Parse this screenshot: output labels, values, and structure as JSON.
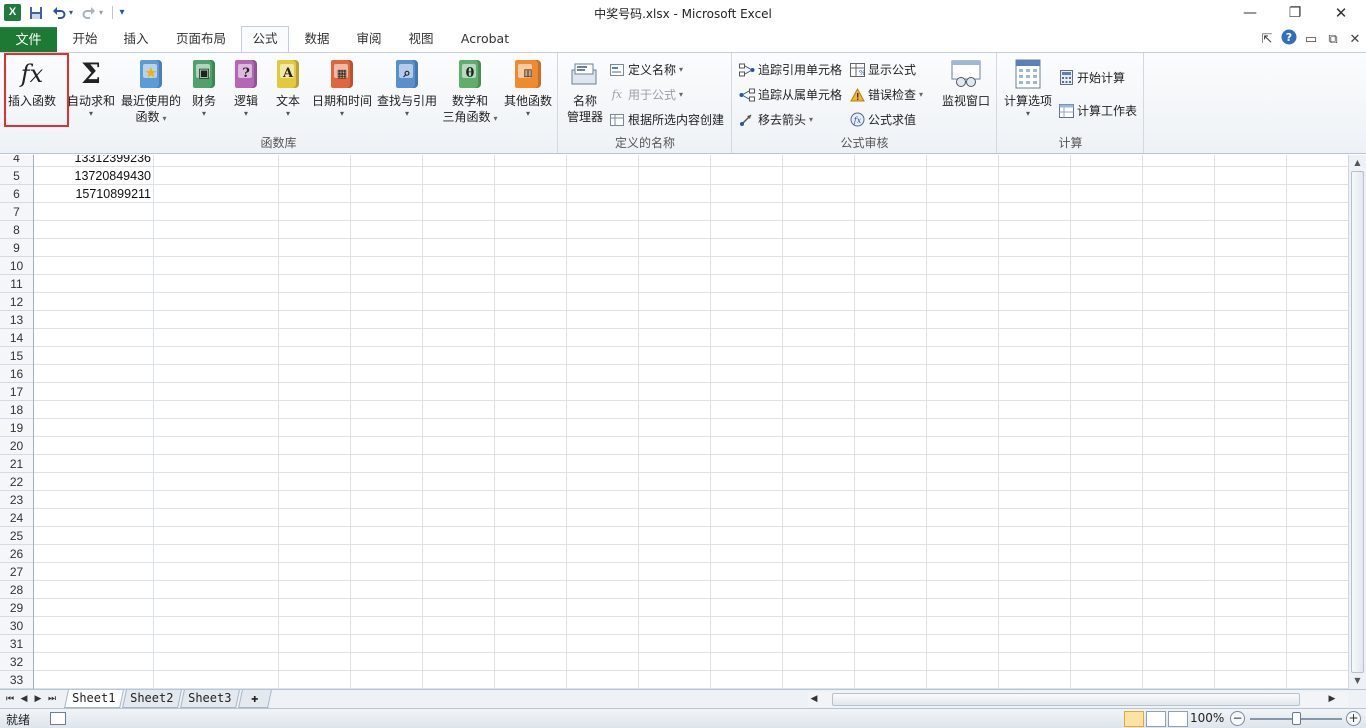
{
  "window": {
    "title": "中奖号码.xlsx  -  Microsoft Excel",
    "app_icon_letter": "X",
    "controls": {
      "minimize": "—",
      "restore": "❐",
      "close": "✕"
    }
  },
  "quick_access": {
    "save_icon": "save-icon",
    "undo_icon": "undo-icon",
    "redo_icon": "redo-icon",
    "customize": "▾"
  },
  "tabs": {
    "file": "文件",
    "items": [
      "开始",
      "插入",
      "页面布局",
      "公式",
      "数据",
      "审阅",
      "视图",
      "Acrobat"
    ],
    "active": "公式"
  },
  "colors": {
    "file_tab": "#1d7a34",
    "highlight_box": "#e0302f",
    "active_view": "#fbe3a4"
  },
  "ribbon": {
    "function_library": {
      "label": "函数库",
      "insert_function": "插入函数",
      "autosum": "自动求和",
      "recently_used": [
        "最近使用的",
        "函数"
      ],
      "financial": "财务",
      "logical": "逻辑",
      "text": "文本",
      "date_time": "日期和时间",
      "lookup": "查找与引用",
      "math": [
        "数学和",
        "三角函数"
      ],
      "more": "其他函数"
    },
    "defined_names": {
      "label": "定义的名称",
      "name_manager": [
        "名称",
        "管理器"
      ],
      "define_name": "定义名称",
      "use_in_formula": "用于公式",
      "create_from_selection": "根据所选内容创建"
    },
    "formula_auditing": {
      "label": "公式审核",
      "trace_precedents": "追踪引用单元格",
      "trace_dependents": "追踪从属单元格",
      "remove_arrows": "移去箭头",
      "show_formulas": "显示公式",
      "error_checking": "错误检查",
      "evaluate_formula": "公式求值",
      "watch_window": "监视窗口"
    },
    "calculation": {
      "label": "计算",
      "calc_options": "计算选项",
      "calc_now": "开始计算",
      "calc_sheet": "计算工作表"
    }
  },
  "sheet": {
    "row_numbers": [
      "4",
      "5",
      "6",
      "7",
      "8",
      "9",
      "10",
      "11",
      "12",
      "13",
      "14",
      "15",
      "16",
      "17",
      "18",
      "19",
      "20",
      "21",
      "22",
      "23",
      "24",
      "25",
      "26",
      "27",
      "28",
      "29",
      "30",
      "31",
      "32",
      "33"
    ],
    "column_a_values": [
      "13312399236",
      "13720849430",
      "15710899211"
    ]
  },
  "sheet_tabs": [
    "Sheet1",
    "Sheet2",
    "Sheet3"
  ],
  "status": {
    "ready": "就绪",
    "zoom": "100%"
  }
}
